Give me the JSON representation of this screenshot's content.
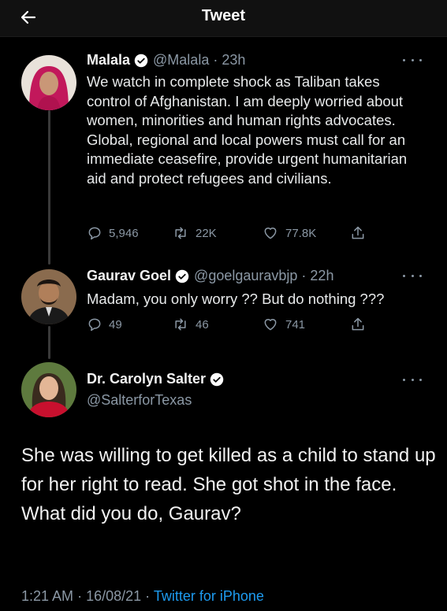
{
  "header": {
    "title": "Tweet"
  },
  "tweets": [
    {
      "name": "Malala",
      "handle": "@Malala",
      "time": "23h",
      "text": "We watch in complete shock as Taliban takes control of Afghanistan. I am deeply worried about women, minorities and human rights advocates. Global, regional and local powers must call for an immediate ceasefire, provide urgent humanitarian aid and protect refugees and civilians.",
      "replies": "5,946",
      "retweets": "22K",
      "likes": "77.8K"
    },
    {
      "name": "Gaurav Goel",
      "handle": "@goelgauravbjp",
      "time": "22h",
      "text": "Madam, you only worry ?? But do nothing ???",
      "replies": "49",
      "retweets": "46",
      "likes": "741"
    }
  ],
  "main_tweet": {
    "name": "Dr. Carolyn Salter",
    "handle": "@SalterforTexas",
    "text": "She was willing to get killed as a child to stand up for her right to read. She got shot in the face. What did you do, Gaurav?",
    "time": "1:21 AM",
    "date": "16/08/21",
    "source": "Twitter for iPhone"
  },
  "colors": {
    "accent": "#1d9bf0",
    "secondary_text": "#8b98a5",
    "background": "#000000"
  },
  "icons": [
    "back-arrow-icon",
    "verified-icon",
    "more-icon",
    "reply-icon",
    "retweet-icon",
    "like-icon",
    "share-icon"
  ]
}
